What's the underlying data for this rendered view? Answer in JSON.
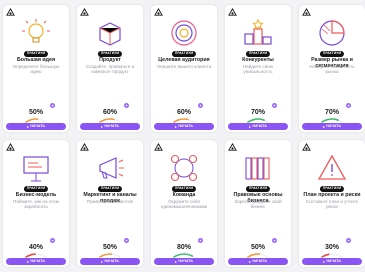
{
  "cards": [
    {
      "badge": "ПРАКТИУМ",
      "title": "Большая идея",
      "desc": "Определите большую идею",
      "progress": "50%",
      "button": "НАЧАТЬ",
      "icon": "lightbulb-icon"
    },
    {
      "badge": "ПРАКТИУМ",
      "title": "Продукт",
      "desc": "Создайте, проверьте и измерьте продукт",
      "progress": "60%",
      "button": "НАЧАТЬ",
      "icon": "product-box-icon"
    },
    {
      "badge": "ПРАКТИУМ",
      "title": "Целевая аудитория",
      "desc": "Опишите вашего клиента",
      "progress": "60%",
      "button": "НАЧАТЬ",
      "icon": "target-icon"
    },
    {
      "badge": "ПРАКТИУМ",
      "title": "Конкуренты",
      "desc": "Найдите свою уникальность",
      "progress": "70%",
      "button": "НАЧАТЬ",
      "icon": "podium-icon"
    },
    {
      "badge": "ПРАКТИУМ",
      "title": "Размер рынка и сегментация",
      "desc": "Измерьте свою часть рынка",
      "progress": "70%",
      "button": "НАЧАТЬ",
      "icon": "pie-chart-icon"
    },
    {
      "badge": "ПРАКТИУМ",
      "title": "Бизнес-модель",
      "desc": "Поймите, как на этом заработать",
      "progress": "40%",
      "button": "НАЧАТЬ",
      "icon": "presentation-board-icon"
    },
    {
      "badge": "ПРАКТИУМ",
      "title": "Маркетинг и каналы продаж",
      "desc": "Привлеките клиентов",
      "progress": "50%",
      "button": "НАЧАТЬ",
      "icon": "megaphone-icon"
    },
    {
      "badge": "ПРАКТИУМ",
      "title": "Команда",
      "desc": "Окружите себя единомышленниками",
      "progress": "80%",
      "button": "НАЧАТЬ",
      "icon": "team-circles-icon"
    },
    {
      "badge": "ПРАКТИУМ",
      "title": "Правовые основы бизнеса",
      "desc": "Зарегистрируйте свой бизнес",
      "progress": "50%",
      "button": "НАЧАТЬ",
      "icon": "books-icon"
    },
    {
      "badge": "ПРАКТИУМ",
      "title": "План проекта и риски",
      "desc": "Составьте план и учтите риски",
      "progress": "30%",
      "button": "НАЧАТЬ",
      "icon": "warning-triangle-icon"
    }
  ],
  "colors": {
    "accent": "#8b54f5",
    "dot": "#9b6bff",
    "arc_red": "#e84a4a",
    "arc_orange": "#f29a3a",
    "arc_green": "#3fb96a"
  }
}
